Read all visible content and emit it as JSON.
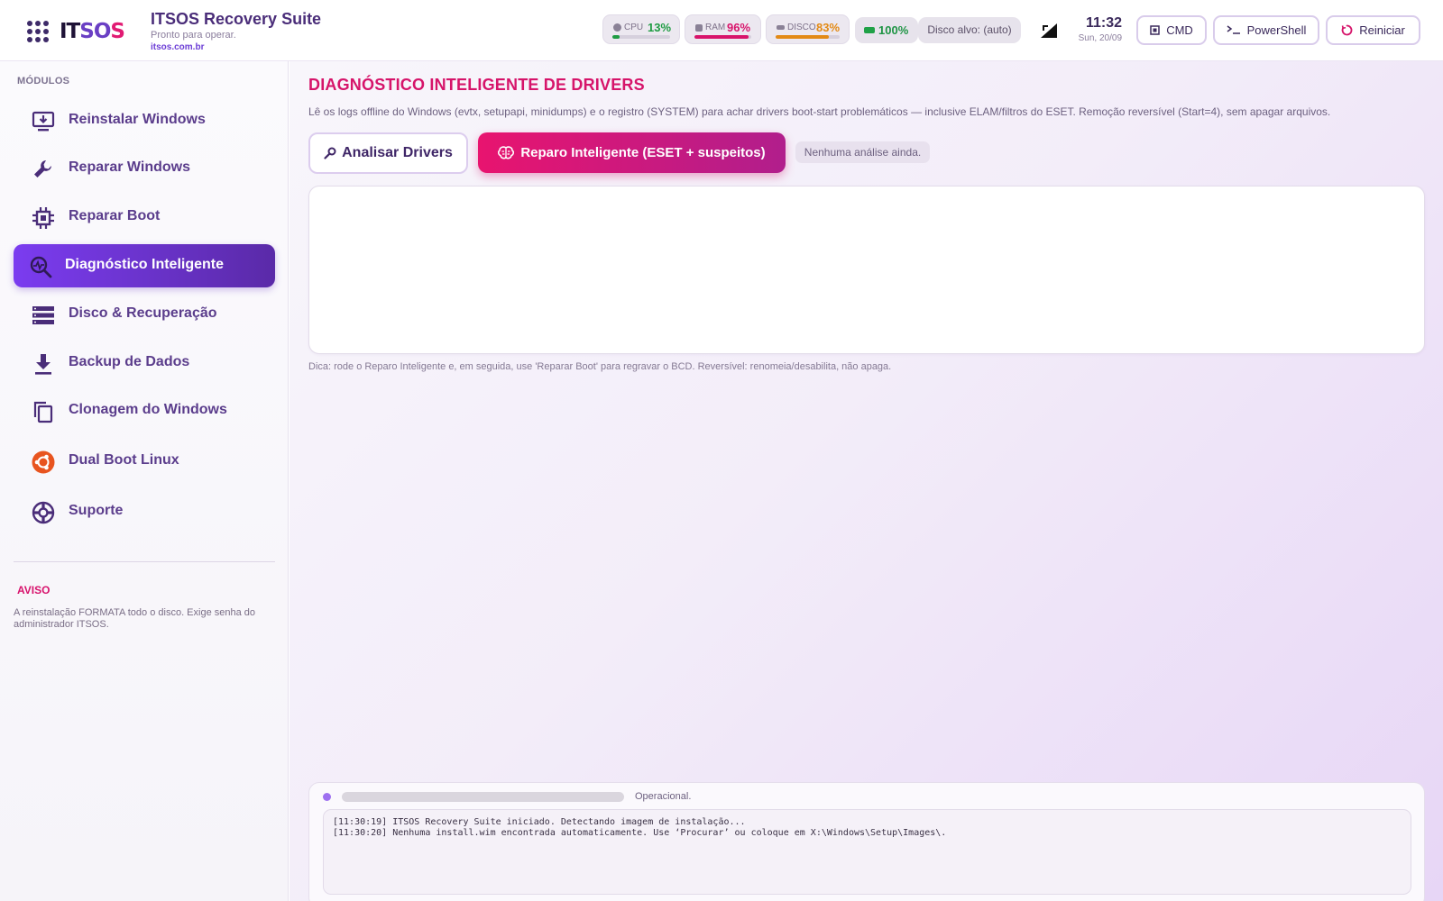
{
  "app": {
    "logo_text_it": "IT",
    "logo_text_so": "SO",
    "logo_text_s": "S",
    "title": "ITSOS Recovery Suite",
    "status": "Pronto para operar.",
    "link": "itsos.com.br"
  },
  "stats": {
    "cpu": {
      "label": "CPU",
      "value": "13%",
      "percent": 13,
      "color": "#1f9c43"
    },
    "ram": {
      "label": "RAM",
      "value": "96%",
      "percent": 96,
      "color": "#d8146b"
    },
    "disk": {
      "label": "DISCO",
      "value": "83%",
      "percent": 83,
      "color": "#e38a15"
    },
    "battery": {
      "value": "100%",
      "color": "#1f9c43"
    },
    "disk_target": "Disco alvo: (auto)"
  },
  "clock": {
    "time": "11:32",
    "date": "Sun, 20/09"
  },
  "header_buttons": {
    "cmd": "CMD",
    "powershell": "PowerShell",
    "reboot": "Reiniciar"
  },
  "sidebar": {
    "heading": "MÓDULOS",
    "items": [
      {
        "label": "Reinstalar Windows",
        "icon": "monitor-download-icon"
      },
      {
        "label": "Reparar Windows",
        "icon": "wrench-icon"
      },
      {
        "label": "Reparar Boot",
        "icon": "chip-icon"
      },
      {
        "label": "Diagnóstico Inteligente",
        "icon": "magnifier-pulse-icon",
        "active": true
      },
      {
        "label": "Disco & Recuperação",
        "icon": "storage-icon"
      },
      {
        "label": "Backup de Dados",
        "icon": "download-icon"
      },
      {
        "label": "Clonagem do Windows",
        "icon": "copy-icon"
      },
      {
        "label": "Dual Boot Linux",
        "icon": "ubuntu-icon"
      },
      {
        "label": "Suporte",
        "icon": "lifebuoy-icon"
      }
    ],
    "warning_title": "AVISO",
    "warning_text": "A reinstalação FORMATA todo o disco. Exige senha do administrador ITSOS."
  },
  "main": {
    "title": "DIAGNÓSTICO INTELIGENTE DE DRIVERS",
    "description": "Lê os logs offline do Windows (evtx, setupapi, minidumps) e o registro (SYSTEM) para achar drivers boot-start problemáticos — inclusive ELAM/filtros do ESET. Remoção reversível (Start=4), sem apagar arquivos.",
    "analyze_button": "Analisar Drivers",
    "repair_button": "Reparo Inteligente (ESET + suspeitos)",
    "analysis_status": "Nenhuma análise ainda.",
    "tip": "Dica: rode o Reparo Inteligente e, em seguida, use 'Reparar Boot' para regravar o BCD. Reversível: renomeia/desabilita, não apaga."
  },
  "console": {
    "progress_percent": 0,
    "status": "Operacional.",
    "log": [
      "[11:30:19] ITSOS Recovery Suite iniciado. Detectando imagem de instalação...",
      "[11:30:20] Nenhuma install.wim encontrada automaticamente. Use ‘Procurar’ ou coloque em X:\\Windows\\Setup\\Images\\."
    ]
  }
}
